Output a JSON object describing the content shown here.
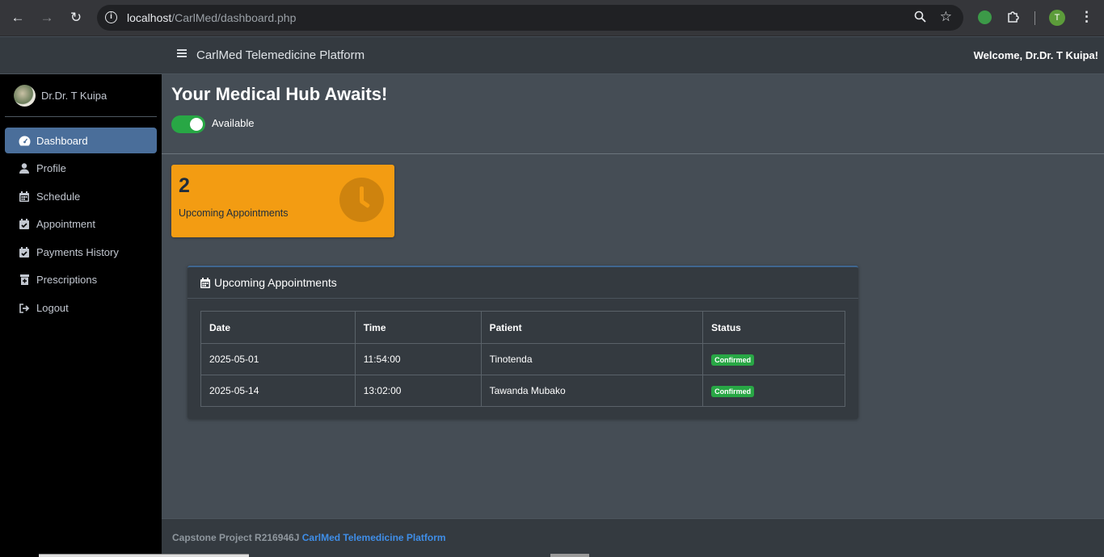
{
  "browser": {
    "url_host": "localhost",
    "url_path": "/CarlMed/dashboard.php",
    "profile_initial": "T"
  },
  "topbar": {
    "title": "CarlMed Telemedicine Platform",
    "welcome": "Welcome, Dr.Dr. T Kuipa!"
  },
  "sidebar": {
    "user_name": "Dr.Dr. T Kuipa",
    "items": [
      {
        "label": "Dashboard",
        "icon": "dashboard-icon",
        "active": true
      },
      {
        "label": "Profile",
        "icon": "user-icon"
      },
      {
        "label": "Schedule",
        "icon": "calendar-icon"
      },
      {
        "label": "Appointment",
        "icon": "calendar-check-icon"
      },
      {
        "label": "Payments History",
        "icon": "calendar-check-icon"
      },
      {
        "label": "Prescriptions",
        "icon": "prescription-icon"
      },
      {
        "label": "Logout",
        "icon": "logout-icon"
      }
    ]
  },
  "main": {
    "heading": "Your Medical Hub Awaits!",
    "availability_label": "Available",
    "availability_on": true,
    "stat": {
      "count": "2",
      "label": "Upcoming Appointments",
      "color": "#f39c12"
    },
    "card": {
      "title": "Upcoming Appointments",
      "columns": [
        "Date",
        "Time",
        "Patient",
        "Status"
      ],
      "rows": [
        {
          "date": "2025-05-01",
          "time": "11:54:00",
          "patient": "Tinotenda",
          "status": "Confirmed"
        },
        {
          "date": "2025-05-14",
          "time": "13:02:00",
          "patient": "Tawanda Mubako",
          "status": "Confirmed"
        }
      ]
    }
  },
  "footer": {
    "text": "Capstone Project R216946J",
    "link": "CarlMed Telemedicine Platform"
  },
  "colors": {
    "accent": "#4a6e9a",
    "success": "#28a745",
    "warning": "#f39c12",
    "link": "#3f8ee8"
  }
}
